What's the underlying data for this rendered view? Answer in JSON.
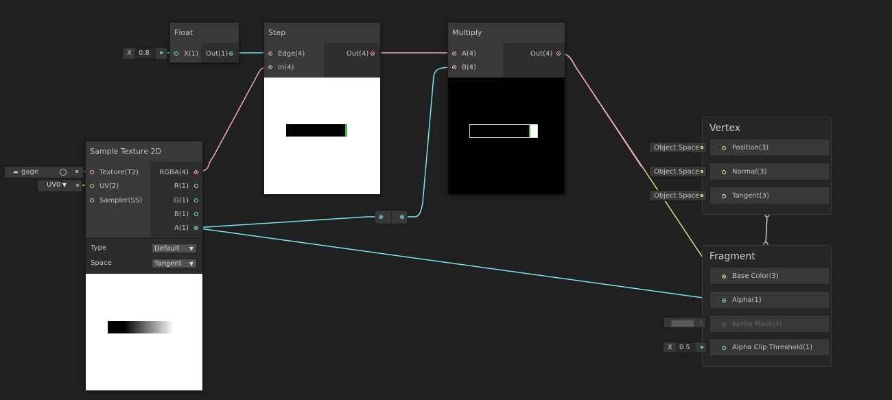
{
  "nodes": {
    "float": {
      "title": "Float",
      "input_label": "X(1)",
      "output_label": "Out(1)",
      "x_field_label": "X",
      "x_value": "0.8"
    },
    "step": {
      "title": "Step",
      "inputs": [
        "Edge(4)",
        "In(4)"
      ],
      "output_label": "Out(4)"
    },
    "multiply": {
      "title": "Multiply",
      "inputs": [
        "A(4)",
        "B(4)"
      ],
      "output_label": "Out(4)"
    },
    "sample_texture": {
      "title": "Sample Texture 2D",
      "inputs": [
        "Texture(T2)",
        "UV(2)",
        "Sampler(SS)"
      ],
      "outputs": [
        "RGBA(4)",
        "R(1)",
        "G(1)",
        "B(1)",
        "A(1)"
      ],
      "type_label": "Type",
      "type_value": "Default",
      "space_label": "Space",
      "space_value": "Tangent",
      "texture_field": "gage",
      "uv_value": "UV0"
    }
  },
  "master": {
    "vertex": {
      "title": "Vertex",
      "slots": [
        {
          "label": "Position(3)",
          "space": "Object Space"
        },
        {
          "label": "Normal(3)",
          "space": "Object Space"
        },
        {
          "label": "Tangent(3)",
          "space": "Object Space"
        }
      ]
    },
    "fragment": {
      "title": "Fragment",
      "slots": [
        "Base Color(3)",
        "Alpha(1)",
        "Sprite Mask(4)",
        "Alpha Clip Threshold(1)"
      ],
      "alpha_clip_field_label": "X",
      "alpha_clip_value": "0.5"
    }
  },
  "colors": {
    "background": "#202020",
    "wire_float": "#84e4e7",
    "wire_vector4": "#f4a8cf",
    "wire_vector3": "#f2ee9a",
    "wire_vector2": "#9ae07f"
  }
}
